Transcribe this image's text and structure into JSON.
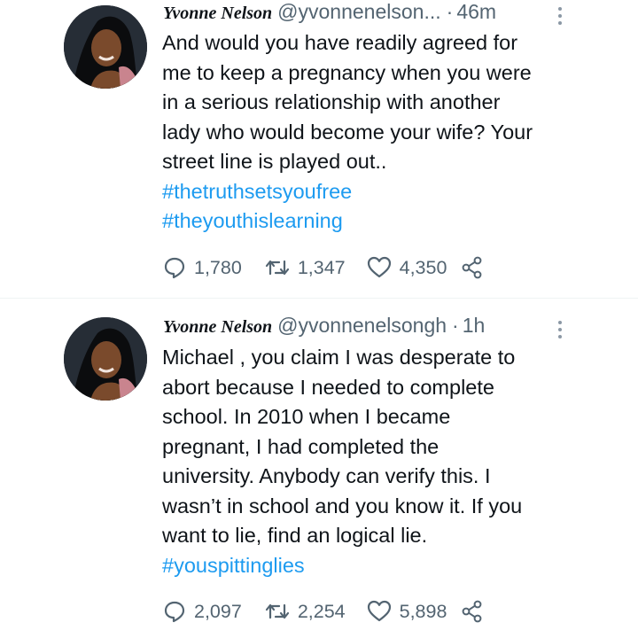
{
  "tweets": [
    {
      "display_name": "Yvonne Nelson",
      "handle": "@yvonnenelson...",
      "separator": "·",
      "time": "46m",
      "text_lines": [
        "And would you have readily agreed for",
        "me to keep a pregnancy when you were",
        "in a serious relationship with another",
        "lady who would become your wife? Your",
        "street line is played out.."
      ],
      "hashtags": [
        "#thetruthsetsyoufree",
        "#theyouthislearning"
      ],
      "replies": "1,780",
      "retweets": "1,347",
      "likes": "4,350"
    },
    {
      "display_name": "Yvonne Nelson",
      "handle": "@yvonnenelsongh",
      "separator": "·",
      "time": "1h",
      "text_lines": [
        "Michael , you claim I was desperate to",
        "abort because I needed to complete",
        "school. In 2010 when I became",
        "pregnant, I had completed the",
        "university. Anybody can verify this. I",
        "wasn’t in school and you know it. If you",
        "want to lie, find an logical lie."
      ],
      "hashtags": [
        "#youspittinglies"
      ],
      "replies": "2,097",
      "retweets": "2,254",
      "likes": "5,898"
    }
  ],
  "icons": {
    "reply": "reply-icon",
    "retweet": "retweet-icon",
    "like": "heart-icon",
    "share": "share-icon",
    "more": "more-options-icon"
  },
  "colors": {
    "text": "#0f1419",
    "secondary": "#536471",
    "hashtag": "#1d9bf0",
    "divider": "#eff3f4"
  }
}
